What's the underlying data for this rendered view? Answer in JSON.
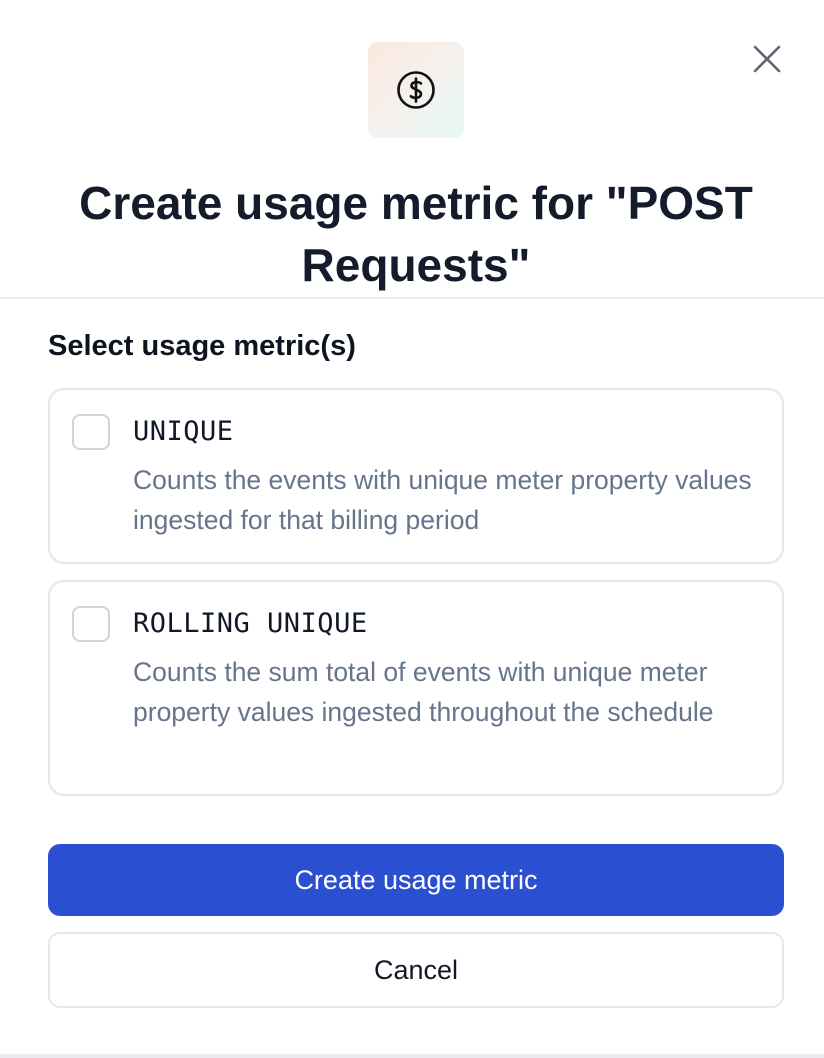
{
  "dialog": {
    "title": "Create usage metric for \"POST Requests\"",
    "header_icon": "dollar-circle-icon",
    "close_icon": "close-icon"
  },
  "selection": {
    "label": "Select usage metric(s)",
    "options": [
      {
        "title": "UNIQUE",
        "description": "Counts the events with unique meter property values ingested for that billing period",
        "checked": false
      },
      {
        "title": "ROLLING UNIQUE",
        "description": "Counts the sum total of events with unique meter property values ingested throughout the schedule",
        "checked": false
      }
    ]
  },
  "actions": {
    "primary_label": "Create usage metric",
    "secondary_label": "Cancel"
  },
  "colors": {
    "primary": "#2b4fd1",
    "title_text": "#141b2b",
    "description_text": "#66758c",
    "border": "#e4e7eb"
  }
}
